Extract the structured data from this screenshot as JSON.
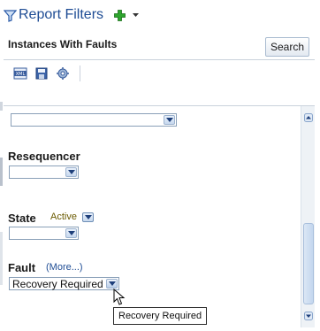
{
  "header": {
    "title": "Report Filters",
    "add_icon": "green-plus-icon",
    "menu_icon": "caret-down-icon"
  },
  "section": {
    "title": "Instances With Faults",
    "search_label": "Search"
  },
  "toolbar": {
    "icons": [
      "xml-export-icon",
      "save-icon",
      "settings-icon"
    ]
  },
  "filters": {
    "top_select_value": "",
    "resequencer": {
      "label": "Resequencer",
      "value": ""
    },
    "state": {
      "label": "State",
      "active_label": "Active",
      "value": ""
    },
    "fault": {
      "label": "Fault",
      "more_link": "(More...)",
      "value": "Recovery Required"
    }
  },
  "tooltip": {
    "text": "Recovery Required"
  },
  "colors": {
    "accent": "#1e4c94",
    "active_text": "#6a5a00",
    "border": "#8aa0b8"
  }
}
